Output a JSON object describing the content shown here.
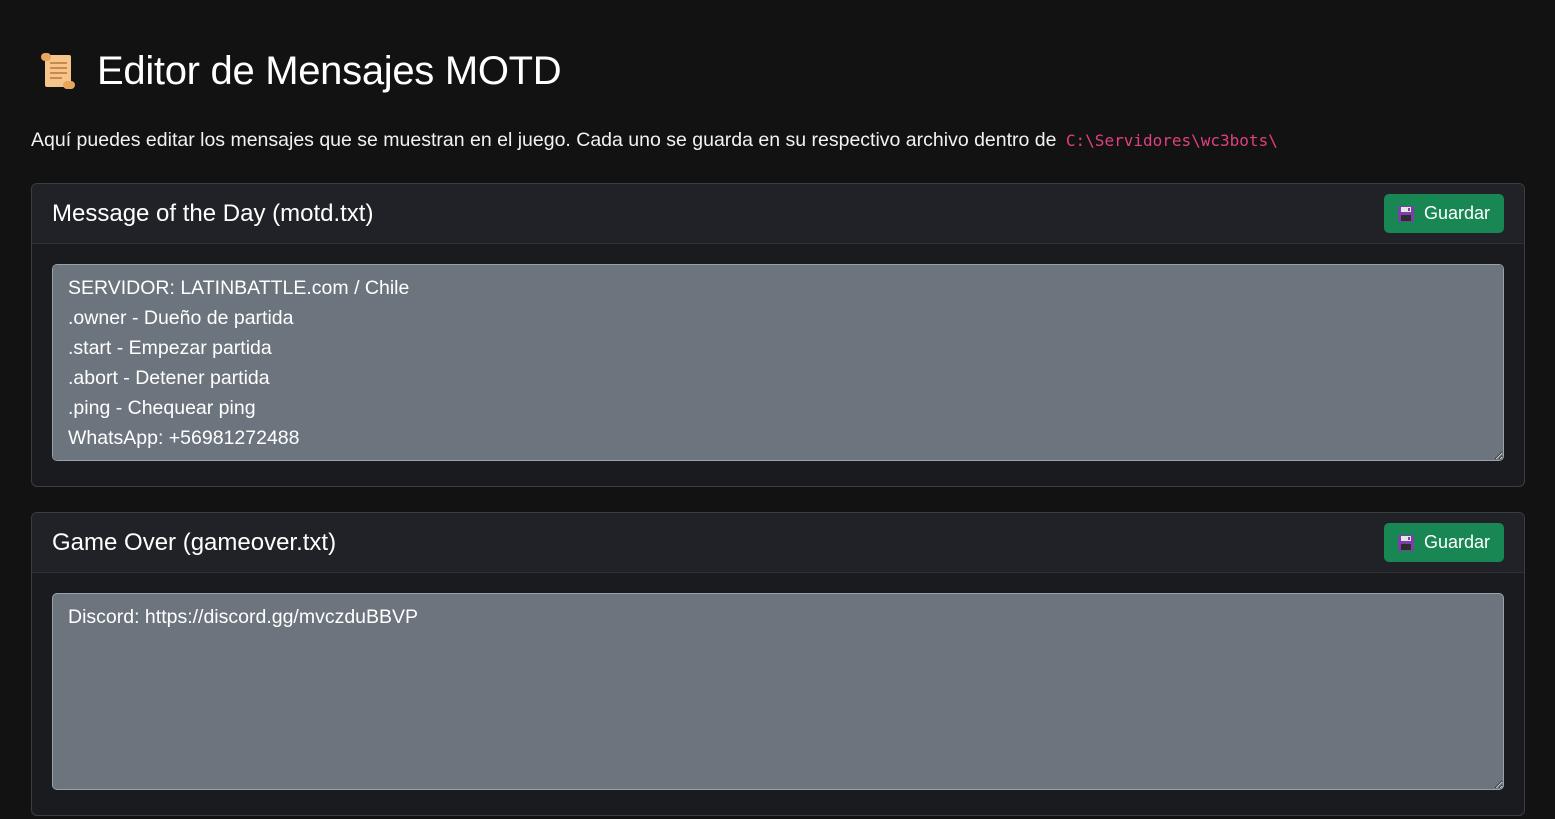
{
  "header": {
    "icon": "scroll-icon",
    "title": "Editor de Mensajes MOTD"
  },
  "intro": {
    "text": "Aquí puedes editar los mensajes que se muestran en el juego. Cada uno se guarda en su respectivo archivo dentro de",
    "path": "C:\\Servidores\\wc3bots\\"
  },
  "cards": [
    {
      "title": "Message of the Day (motd.txt)",
      "save_label": "Guardar",
      "save_icon": "floppy-disk-icon",
      "content": "SERVIDOR: LATINBATTLE.com / Chile\n.owner - Dueño de partida\n.start - Empezar partida\n.abort - Detener partida\n.ping - Chequear ping\nWhatsApp: +56981272488"
    },
    {
      "title": "Game Over (gameover.txt)",
      "save_label": "Guardar",
      "save_icon": "floppy-disk-icon",
      "content": "Discord: https://discord.gg/mvczduBBVP"
    }
  ],
  "colors": {
    "background": "#121212",
    "card": "#1a1b1e",
    "card_header": "#202227",
    "button": "#198754",
    "textarea": "#6c757d",
    "path": "#e0407f"
  }
}
